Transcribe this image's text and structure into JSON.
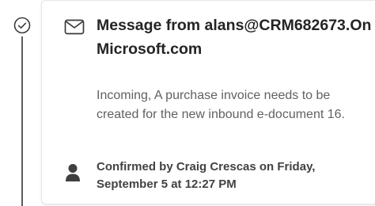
{
  "timeline": {
    "status_icon": "checkmark-circle-icon"
  },
  "card": {
    "icon": "mail-icon",
    "title": "Message from alans@CRM682673.OnMicrosoft.com",
    "description": "Incoming, A purchase invoice needs to be created for the new inbound e-document 16.",
    "confirmed_icon": "person-icon",
    "confirmed_text": "Confirmed by Craig Crescas on Friday, September 5 at 12:27 PM"
  },
  "colors": {
    "title": "#242424",
    "description": "#616161",
    "confirmed": "#424242",
    "timeline_line": "#5c5c5c"
  }
}
